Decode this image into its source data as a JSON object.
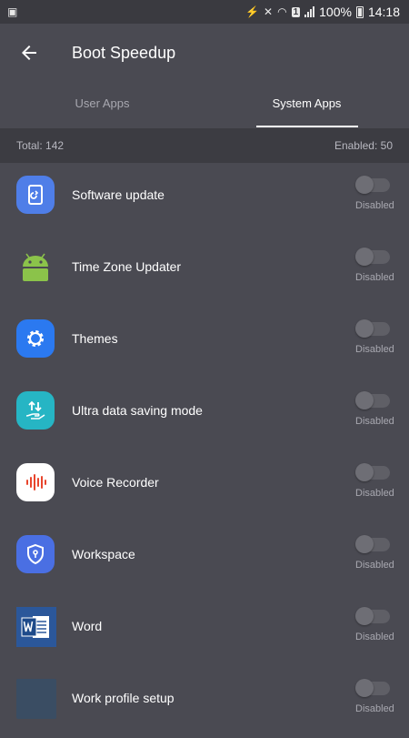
{
  "statusbar": {
    "battery": "100%",
    "time": "14:18",
    "sim": "1"
  },
  "header": {
    "title": "Boot Speedup"
  },
  "tabs": [
    {
      "label": "User Apps",
      "active": false
    },
    {
      "label": "System Apps",
      "active": true
    }
  ],
  "summary": {
    "total": "Total: 142",
    "enabled": "Enabled: 50"
  },
  "apps": [
    {
      "name": "Software update",
      "state": "Disabled",
      "icon": "software-update-icon",
      "color": "#4f7ee8"
    },
    {
      "name": "Time Zone Updater",
      "state": "Disabled",
      "icon": "android-icon",
      "color": "#8bc34a"
    },
    {
      "name": "Themes",
      "state": "Disabled",
      "icon": "gear-icon",
      "color": "#2b79f0"
    },
    {
      "name": "Ultra data saving mode",
      "state": "Disabled",
      "icon": "data-saving-icon",
      "color": "#26b5c4"
    },
    {
      "name": "Voice Recorder",
      "state": "Disabled",
      "icon": "voice-recorder-icon",
      "color": "#ffffff"
    },
    {
      "name": "Workspace",
      "state": "Disabled",
      "icon": "shield-lock-icon",
      "color": "#4a6fe3"
    },
    {
      "name": "Word",
      "state": "Disabled",
      "icon": "word-icon",
      "color": "#2b579a"
    },
    {
      "name": "Work profile setup",
      "state": "Disabled",
      "icon": "work-profile-icon",
      "color": "#3a4d63"
    }
  ]
}
